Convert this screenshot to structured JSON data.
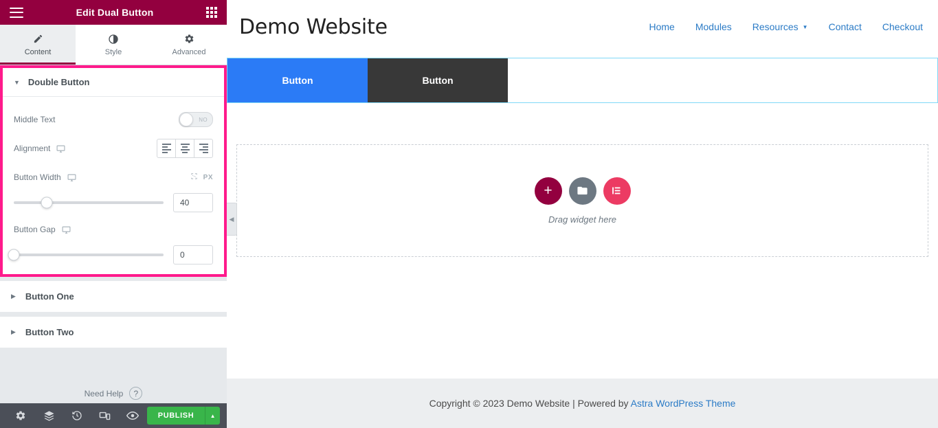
{
  "panel": {
    "header": {
      "title": "Edit Dual Button",
      "menu_icon": "hamburger-icon",
      "apps_icon": "grid-apps-icon"
    },
    "tabs": [
      {
        "label": "Content",
        "icon": "pencil-icon",
        "active": true
      },
      {
        "label": "Style",
        "icon": "contrast-circle-icon",
        "active": false
      },
      {
        "label": "Advanced",
        "icon": "gear-icon",
        "active": false
      }
    ],
    "section": {
      "title": "Double Button",
      "expanded": true,
      "controls": {
        "middle_text": {
          "label": "Middle Text",
          "toggle_state": "NO",
          "enabled": false
        },
        "alignment": {
          "label": "Alignment",
          "device_icon": "desktop-icon",
          "options": [
            "align-left",
            "align-center",
            "align-right"
          ],
          "selected": "align-left"
        },
        "button_width": {
          "label": "Button Width",
          "device_icon": "desktop-icon",
          "unit_icon": "custom-unit-icon",
          "unit": "PX",
          "value": "40",
          "slider_percent": 22
        },
        "button_gap": {
          "label": "Button Gap",
          "device_icon": "desktop-icon",
          "value": "0",
          "slider_percent": 0
        }
      }
    },
    "accordions": [
      {
        "title": "Button One",
        "expanded": false
      },
      {
        "title": "Button Two",
        "expanded": false
      }
    ],
    "need_help": {
      "label": "Need Help",
      "icon": "question-circle-icon"
    },
    "footer": {
      "icons": [
        "gear-icon",
        "layers-icon",
        "history-icon",
        "responsive-mode-icon",
        "preview-eye-icon"
      ],
      "publish_label": "PUBLISH",
      "publish_arrow": "chevron-up-icon"
    },
    "collapse_handle": "chevron-left-icon"
  },
  "canvas": {
    "site": {
      "logo": "Demo Website",
      "nav": [
        {
          "label": "Home",
          "has_caret": false
        },
        {
          "label": "Modules",
          "has_caret": false
        },
        {
          "label": "Resources",
          "has_caret": true
        },
        {
          "label": "Contact",
          "has_caret": false
        },
        {
          "label": "Checkout",
          "has_caret": false
        }
      ]
    },
    "widget": {
      "button_one": {
        "label": "Button",
        "color": "#2b7bf6"
      },
      "button_two": {
        "label": "Button",
        "color": "#383838"
      }
    },
    "dropzone": {
      "text": "Drag widget here",
      "icons": [
        "add-plus-icon",
        "folder-template-icon",
        "elementor-logo-icon"
      ]
    },
    "footer": {
      "text": "Copyright © 2023 Demo Website | Powered by ",
      "link": "Astra WordPress Theme"
    }
  },
  "colors": {
    "brand_maroon": "#93003f",
    "highlight_pink": "#ff1a8c",
    "publish_green": "#39b54a",
    "link_blue": "#2b7bc6",
    "button_blue": "#2b7bf6"
  }
}
